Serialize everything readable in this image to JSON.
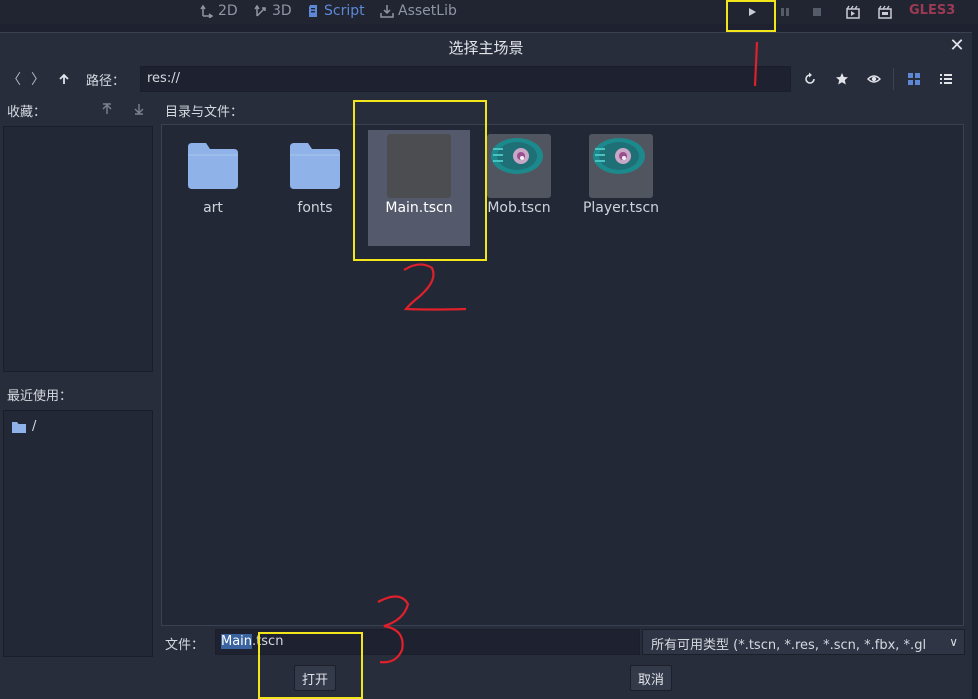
{
  "topbar": {
    "workspaces": [
      {
        "label": "2D",
        "icon": "2d-workspace-icon"
      },
      {
        "label": "3D",
        "icon": "3d-workspace-icon"
      },
      {
        "label": "Script",
        "icon": "script-workspace-icon"
      },
      {
        "label": "AssetLib",
        "icon": "assetlib-icon"
      }
    ],
    "run_buttons": [
      "play-icon",
      "pause-icon",
      "stop-icon",
      "play-scene-icon",
      "play-custom-scene-icon"
    ],
    "renderer": "GLES3"
  },
  "dialog": {
    "title": "选择主场景",
    "path_label": "路径：",
    "path_value": "res://",
    "favorites_label": "收藏：",
    "recent_label": "最近使用：",
    "recent_items": [
      "/"
    ],
    "files_label": "目录与文件：",
    "files": [
      {
        "name": "art",
        "type": "folder"
      },
      {
        "name": "fonts",
        "type": "folder"
      },
      {
        "name": "Main.tscn",
        "type": "scene",
        "selected": true
      },
      {
        "name": "Mob.tscn",
        "type": "scene"
      },
      {
        "name": "Player.tscn",
        "type": "scene"
      }
    ],
    "file_label": "文件：",
    "file_value_selected": "Main",
    "file_value_rest": ".tscn",
    "filter": "所有可用类型 (*.tscn, *.res, *.scn, *.fbx, *.gl",
    "open_button": "打开",
    "cancel_button": "取消"
  },
  "annotations": {
    "labels": [
      "1",
      "2",
      "3"
    ],
    "box_color": "#f2e51c",
    "number_color": "#e0202a"
  },
  "colors": {
    "accent": "#5e88d6",
    "folder": "#8fb3e8",
    "renderer": "#9c3a55"
  }
}
